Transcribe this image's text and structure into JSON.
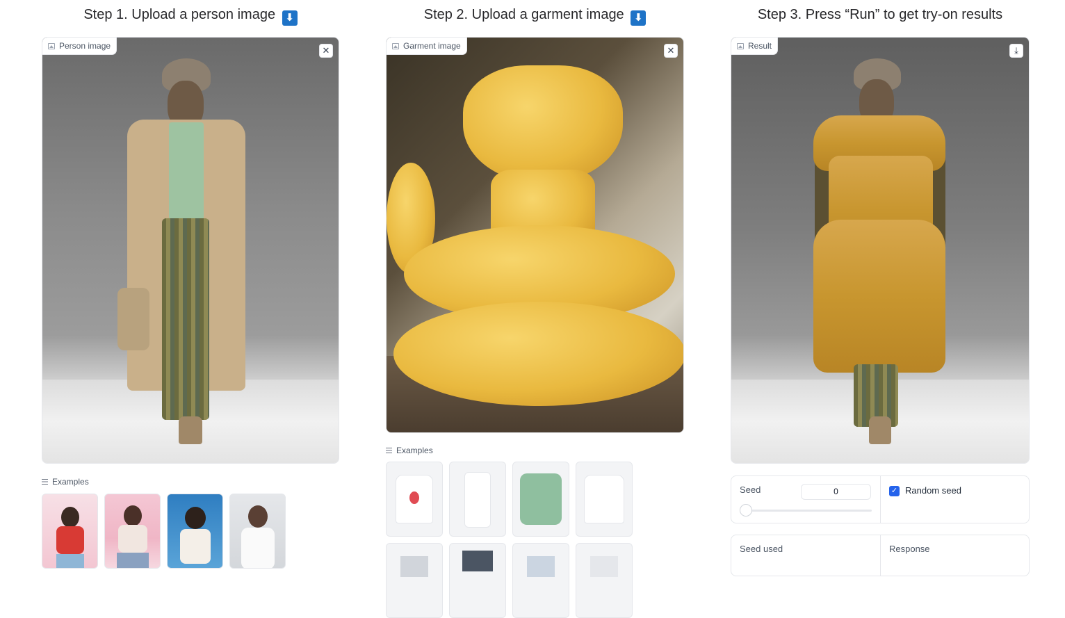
{
  "steps": {
    "step1_title": "Step 1. Upload a person image",
    "step2_title": "Step 2. Upload a garment image",
    "step3_title": "Step 3. Press “Run” to get try-on results",
    "arrow_glyph": "⬇"
  },
  "person": {
    "label": "Person image",
    "clear_glyph": "✕",
    "examples_label": "Examples"
  },
  "garment": {
    "label": "Garment image",
    "clear_glyph": "✕",
    "examples_label": "Examples"
  },
  "result": {
    "label": "Result",
    "download_glyph": "⤓"
  },
  "controls": {
    "seed_label": "Seed",
    "seed_value": "0",
    "random_seed_label": "Random seed",
    "random_seed_checked": true,
    "checkmark_glyph": "✓",
    "seed_used_label": "Seed used",
    "response_label": "Response"
  },
  "colors": {
    "accent": "#2563eb",
    "border": "#e5e7eb",
    "emoji_blue": "#1e73c7"
  }
}
